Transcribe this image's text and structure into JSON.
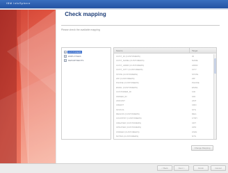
{
  "window": {
    "title": "IBM InfoSphere",
    "accent": "#2453a3"
  },
  "page": {
    "title": "Check mapping",
    "instruction": "Please check the available mapping"
  },
  "tree": {
    "items": [
      {
        "label": "CUSTOMERS",
        "selected": true
      },
      {
        "label": "EMPLOYEES",
        "selected": false
      },
      {
        "label": "DEPARTMENTS",
        "selected": false
      }
    ]
  },
  "table": {
    "columns": [
      "Source",
      "Target"
    ],
    "rows": [
      {
        "source": "CUST_ID (CUSTOMERS)",
        "target": "ID"
      },
      {
        "source": "CUST_NAME (CUSTOMERS)",
        "target": "NAME"
      },
      {
        "source": "CUST_ADDR (CUSTOMERS)",
        "target": "ADDR"
      },
      {
        "source": "CUST_CITY (CUSTOMERS)",
        "target": "CITY"
      },
      {
        "source": "STATE (CUSTOMERS)",
        "target": "STATE"
      },
      {
        "source": "ZIP (CUSTOMERS)",
        "target": "ZIP"
      },
      {
        "source": "PHONE (CUSTOMERS)",
        "target": "PHONE"
      },
      {
        "source": "EMAIL (CUSTOMERS)",
        "target": "EMAIL"
      },
      {
        "source": "CUSTOMER_ID",
        "target": "CID"
      },
      {
        "source": "ORDER_ID",
        "target": "OID"
      },
      {
        "source": "AMOUNT",
        "target": "AMT"
      },
      {
        "source": "CREDIT",
        "target": "CRD"
      },
      {
        "source": "STATUS",
        "target": "STS"
      },
      {
        "source": "REGION (CUSTOMERS)",
        "target": "REG"
      },
      {
        "source": "COUNTRY (CUSTOMERS)",
        "target": "CTRY"
      },
      {
        "source": "CREATED (CUSTOMERS)",
        "target": "CRT"
      },
      {
        "source": "UPDATED (CUSTOMERS)",
        "target": "UPD"
      },
      {
        "source": "OWNER (CUSTOMERS)",
        "target": "OWN"
      },
      {
        "source": "NOTES (CUSTOMERS)",
        "target": "NTS"
      }
    ]
  },
  "buttons": {
    "map_label": "Change Mapping",
    "back_label": "< Back",
    "next_label": "Next >",
    "finish_label": "Finish",
    "cancel_label": "Cancel"
  }
}
